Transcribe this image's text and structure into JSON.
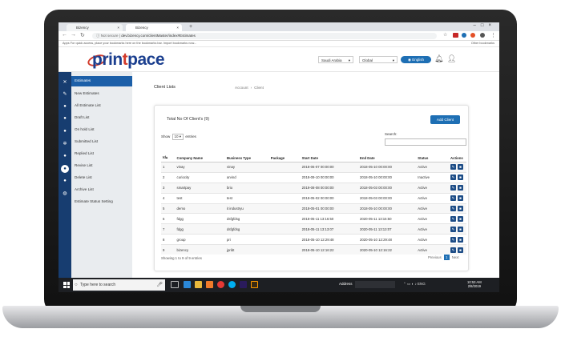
{
  "browser": {
    "tabs": [
      {
        "label": "Bizency",
        "active": false
      },
      {
        "label": "Bizency",
        "active": true
      }
    ],
    "url_prefix": "Not secure",
    "url": "dev.bizency.com/clientMaster/index#Estimates",
    "bookmarks_text": "Apps   For quick access, place your bookmarks here on the bookmarks bar. Import bookmarks now...",
    "other_bookmarks": "Other bookmarks"
  },
  "header": {
    "logo_pre": "prin",
    "logo_accent": "t",
    "logo_post": "pace",
    "country": "Saudi Arabia",
    "scope": "Global",
    "language": "English",
    "accent_color": "#1e6fb4"
  },
  "sidebar": {
    "icons": [
      "close-icon",
      "wrench-icon",
      "group-icon",
      "users-icon",
      "users-icon",
      "cog-icon",
      "group-icon",
      "circle-icon",
      "group-icon",
      "globe-icon"
    ],
    "items": [
      {
        "label": "Estimates",
        "active": true
      },
      {
        "label": "New Estimates"
      },
      {
        "label": "All Estimate List"
      },
      {
        "label": "Draft List"
      },
      {
        "label": "On hold List"
      },
      {
        "label": "Submitted List"
      },
      {
        "label": "Replied List"
      },
      {
        "label": "Revise List"
      },
      {
        "label": "Delete List"
      },
      {
        "label": "Archive List"
      },
      {
        "label": "Estimate Status Setting"
      }
    ]
  },
  "main": {
    "title": "Client Lists",
    "breadcrumb": [
      "Account",
      "Client"
    ],
    "total_label": "Total No Of Client's (9)",
    "add_button": "Add Client",
    "show_label": "Show",
    "show_value": "10",
    "entries_label": "entries",
    "search_label": "Search:",
    "columns": [
      "Id",
      "Company Name",
      "Business Type",
      "Package",
      "Start Date",
      "End Date",
      "Status",
      "Actions"
    ],
    "rows": [
      {
        "id": "1",
        "company": "vinay",
        "business": "vinay",
        "package": "",
        "start": "2018-06-07 00:00:00",
        "end": "2018-05-10 00:00:00",
        "status": "Active"
      },
      {
        "id": "2",
        "company": "curiocity",
        "business": "arvind",
        "package": "",
        "start": "2018-09-10 00:00:00",
        "end": "2018-05-10 00:00:00",
        "status": "Inactive"
      },
      {
        "id": "3",
        "company": "smartpay",
        "business": "brio",
        "package": "",
        "start": "2019-08-08 00:00:00",
        "end": "2018-05-03 00:00:00",
        "status": "Active"
      },
      {
        "id": "4",
        "company": "test",
        "business": "test",
        "package": "",
        "start": "2018-05-02 00:00:00",
        "end": "2018-05-03 00:00:00",
        "status": "Active"
      },
      {
        "id": "5",
        "company": "demo",
        "business": "it industryu",
        "package": "",
        "start": "2018-05-01 00:00:00",
        "end": "2018-05-10 00:00:00",
        "status": "Active"
      },
      {
        "id": "6",
        "company": "fdgg",
        "business": "dsfgfdsg",
        "package": "",
        "start": "2018-05-11 13:16:50",
        "end": "2020-05-11 13:16:50",
        "status": "Active"
      },
      {
        "id": "7",
        "company": "fdgg",
        "business": "dsfgfdsg",
        "package": "",
        "start": "2018-05-11 13:13:07",
        "end": "2020-05-11 13:13:07",
        "status": "Active"
      },
      {
        "id": "8",
        "company": "group",
        "business": "pri",
        "package": "",
        "start": "2018-05-10 12:29:48",
        "end": "2020-05-10 12:29:48",
        "status": "Active"
      },
      {
        "id": "9",
        "company": "bizency",
        "business": "jpribt",
        "package": "",
        "start": "2018-05-10 12:16:22",
        "end": "2020-05-10 12:16:22",
        "status": "Active"
      }
    ],
    "showing": "Showing 1 to 9 of 9 entries",
    "prev": "Previous",
    "page": "1",
    "next": "Next"
  },
  "taskbar": {
    "search_placeholder": "Type here to search",
    "address_label": "Address",
    "tray": "ENG",
    "time": "10:53 AM",
    "date": "2/8/2019"
  }
}
